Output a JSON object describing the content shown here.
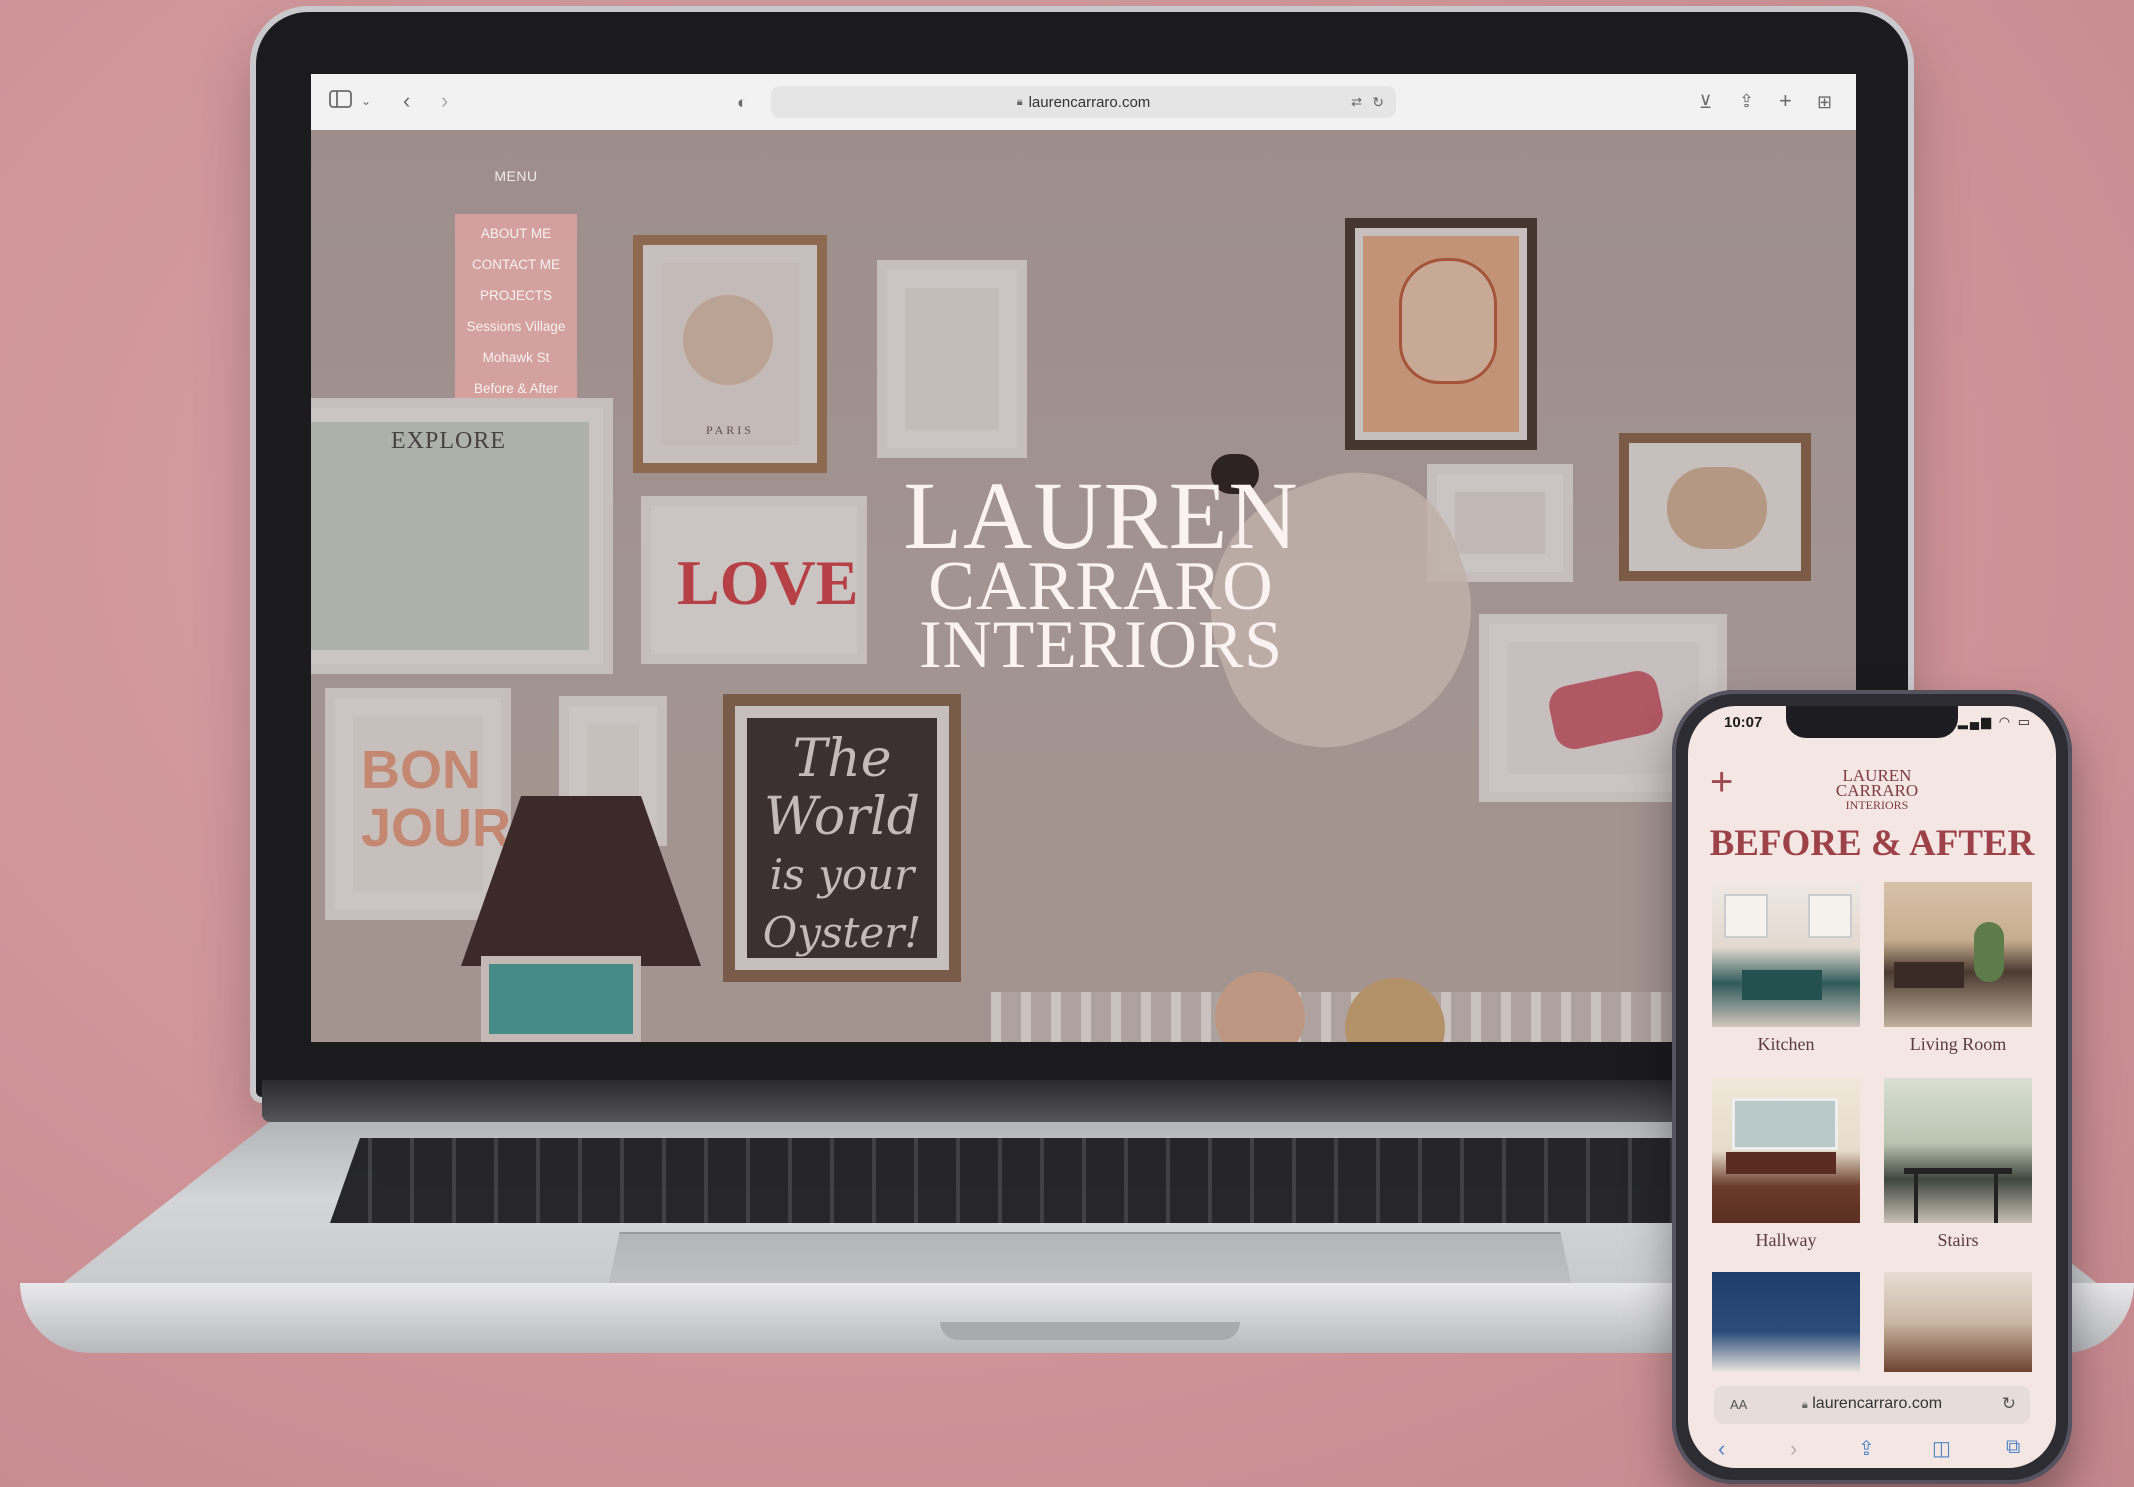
{
  "browser": {
    "url": "laurencarraro.com",
    "icons": [
      "sidebar-icon",
      "chevron-down-icon",
      "back-icon",
      "forward-icon",
      "shield-icon",
      "lock-icon",
      "translate-icon",
      "reload-icon",
      "download-icon",
      "share-icon",
      "new-tab-icon",
      "tab-overview-icon"
    ]
  },
  "site": {
    "menu_label": "MENU",
    "menu_items": [
      "ABOUT ME",
      "CONTACT ME",
      "PROJECTS",
      "Sessions Village",
      "Mohawk St",
      "Before & After"
    ],
    "brand": {
      "line1": "LAUREN",
      "line2": "CARRARO",
      "line3": "INTERIORS"
    },
    "accent_color": "#dba3a2"
  },
  "artwork": {
    "love": "LOVE",
    "paris": "PARIS",
    "explore": "EXPLORE",
    "bonjour_1": "BON",
    "bonjour_2": "JOUR",
    "chalk_1": "The",
    "chalk_2": "World",
    "chalk_3": "is your",
    "chalk_4": "Oyster!"
  },
  "phone": {
    "time": "10:07",
    "logo": {
      "line1": "LAUREN",
      "line2": "CARRARO",
      "line3": "INTERIORS"
    },
    "page_title": "BEFORE & AFTER",
    "rooms": [
      "Kitchen",
      "Living Room",
      "Hallway",
      "Stairs"
    ],
    "url": "laurencarraro.com",
    "aa_label": "AA",
    "brand_color": "#9e4249"
  }
}
